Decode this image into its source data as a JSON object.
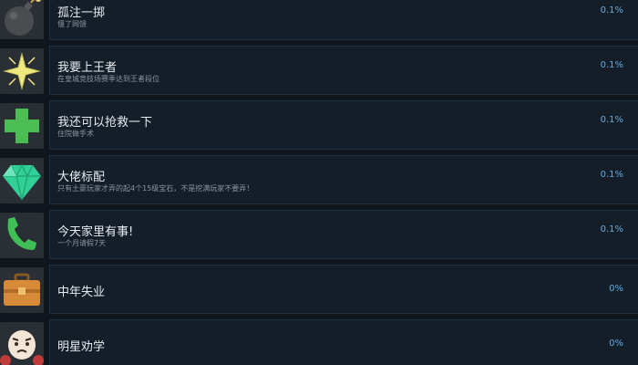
{
  "achievements": [
    {
      "title": "孤注一掷",
      "desc": "偃了网馈",
      "percent": "0.1%",
      "icon": "bomb-icon"
    },
    {
      "title": "我要上王者",
      "desc": "在皇城竞技场赛季达到王者段位",
      "percent": "0.1%",
      "icon": "star-icon"
    },
    {
      "title": "我还可以抢救一下",
      "desc": "住院做手术",
      "percent": "0.1%",
      "icon": "medical-cross-icon"
    },
    {
      "title": "大佬标配",
      "desc": "只有土豪玩家才弄的起4个15级宝石，不是挖满玩家不要弄！",
      "percent": "0.1%",
      "icon": "gem-icon"
    },
    {
      "title": "今天家里有事!",
      "desc": "一个月请假7天",
      "percent": "0.1%",
      "icon": "phone-icon"
    },
    {
      "title": "中年失业",
      "desc": "",
      "percent": "0%",
      "icon": "briefcase-icon"
    },
    {
      "title": "明星劝学",
      "desc": "",
      "percent": "0%",
      "icon": "face-icon"
    }
  ],
  "colors": {
    "background": "#10161e",
    "row_panel": "#141e29",
    "percent_text": "#66a9e1"
  }
}
